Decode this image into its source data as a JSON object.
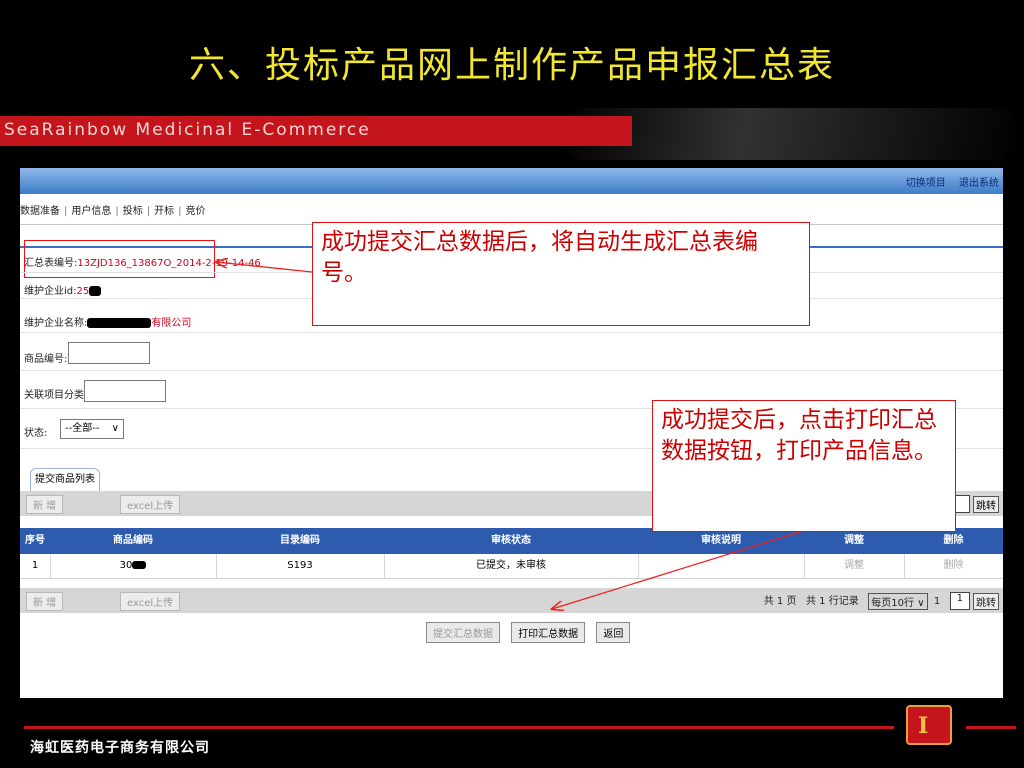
{
  "slide_title": "六、投标产品网上制作产品申报汇总表",
  "brand": "SeaRainbow  Medicinal  E-Commerce",
  "footer_company": "海虹医药电子商务有限公司",
  "app": {
    "top_links": [
      "切换项目",
      "退出系统"
    ],
    "menu": [
      "数据准备",
      "用户信息",
      "投标",
      "开标",
      "竞价"
    ],
    "fields": {
      "summary_code_label": "汇总表编号:",
      "summary_code_value": "13ZJD136_13867O_2014-2-19-14-46",
      "enterprise_id_label": "维护企业id:",
      "enterprise_id_value": "25",
      "enterprise_name_label": "维护企业名称:",
      "enterprise_name_suffix": "有限公司",
      "product_code_label": "商品编号:",
      "related_category_label": "关联项目分类:",
      "status_label": "状态:",
      "status_selected": "--全部--"
    },
    "tab_label": "提交商品列表",
    "toolbar": {
      "add": "新 增",
      "excel_upload": "excel上传",
      "jump": "跳转"
    },
    "table": {
      "columns": [
        "序号",
        "商品编码",
        "目录编码",
        "审核状态",
        "审核说明",
        "调整",
        "删除"
      ],
      "rows": [
        {
          "index": "1",
          "product_code": "30",
          "catalog_code": "S193",
          "audit_status": "已提交，未审核",
          "audit_note": "",
          "adjust": "调整",
          "delete": "删除"
        }
      ]
    },
    "pager": {
      "total_pages": "共 1 页",
      "total_rows": "共 1 行记录",
      "per_page": "每页10行",
      "current_page": "1",
      "page_input": "1",
      "jump": "跳转"
    },
    "bottom_buttons": {
      "submit": "提交汇总数据",
      "print": "打印汇总数据",
      "back": "返回"
    }
  },
  "callouts": {
    "top": "成功提交汇总数据后，将自动生成汇总表编号。",
    "right": "成功提交后，点击打印汇总数据按钮，打印产品信息。"
  },
  "colors": {
    "title": "#f2e62f",
    "brand_red": "#c4151c",
    "table_header": "#2d5caf",
    "callout_text": "#c00000"
  }
}
